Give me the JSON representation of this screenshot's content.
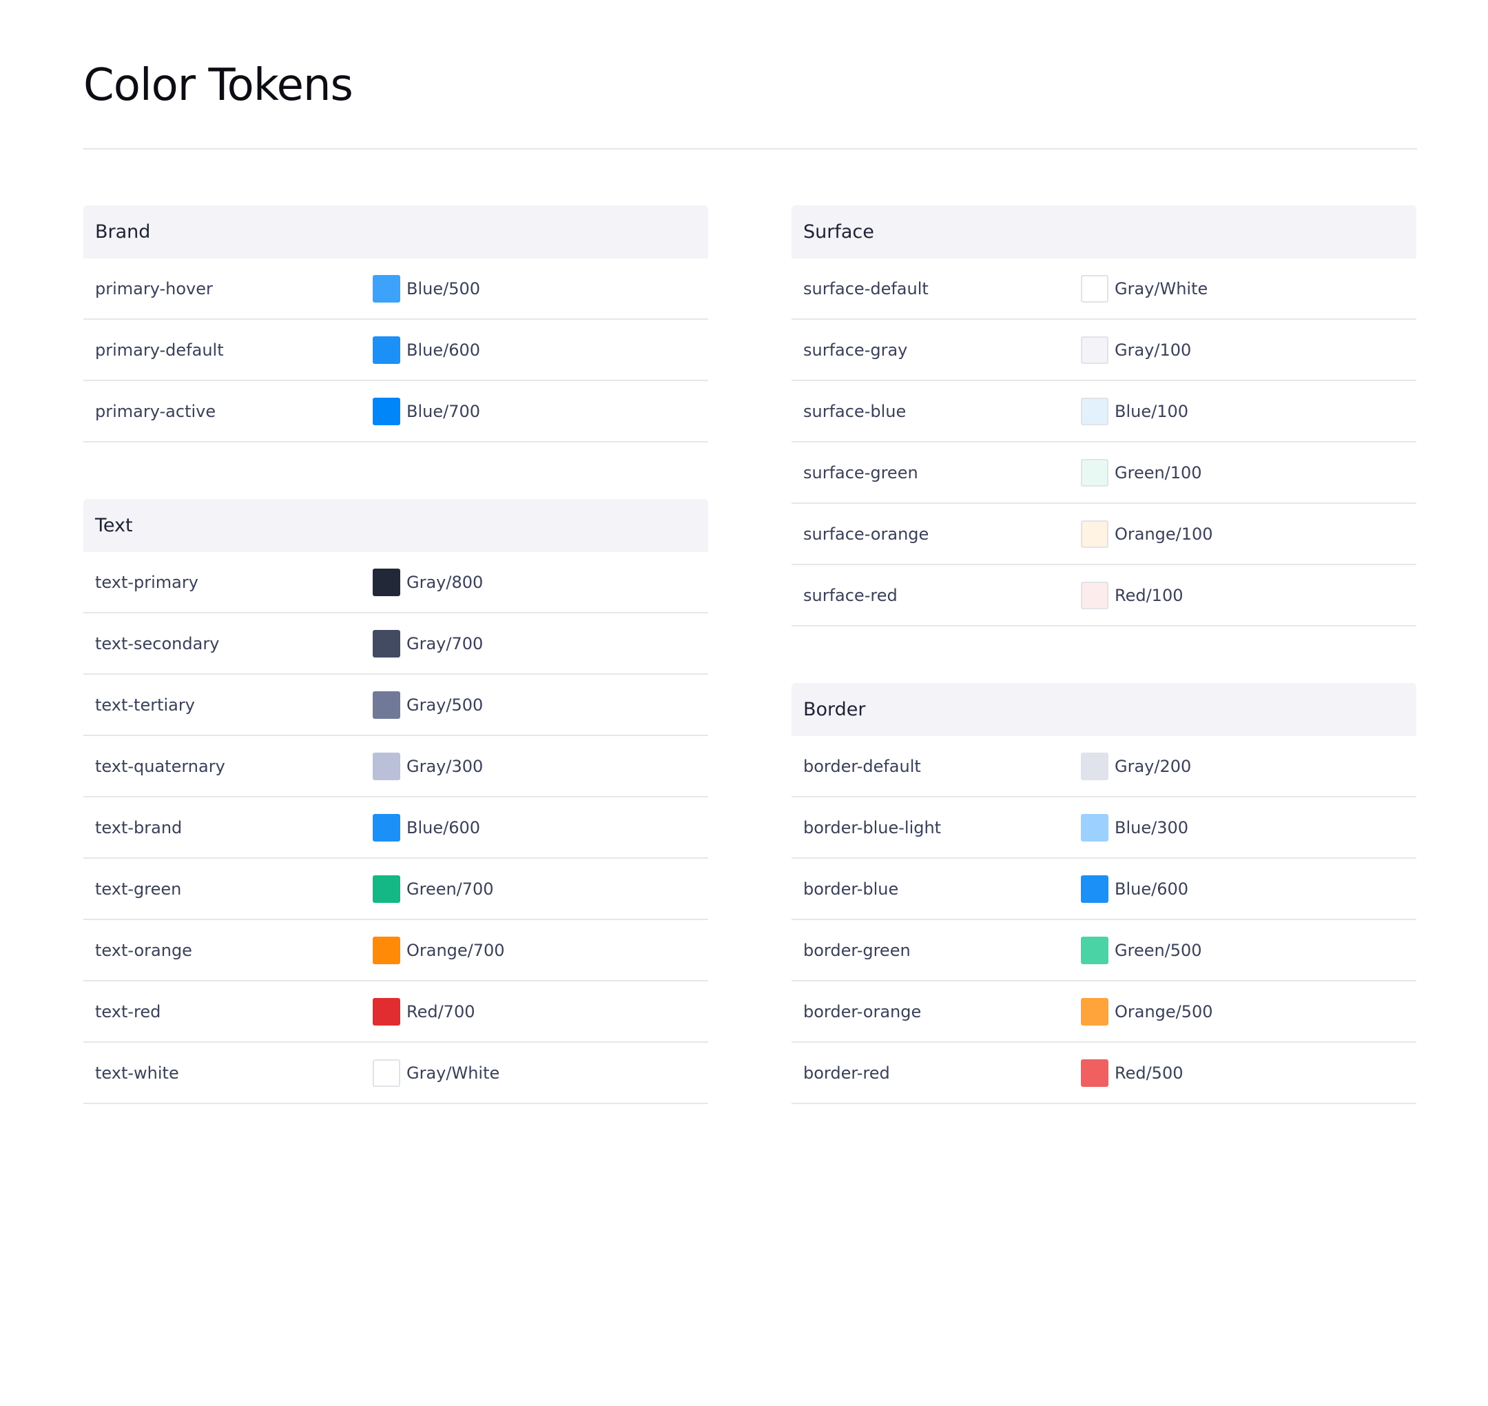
{
  "page": {
    "title": "Color Tokens"
  },
  "sections": {
    "brand": {
      "title": "Brand",
      "rows": [
        {
          "name": "primary-hover",
          "value": "Blue/500",
          "color": "#3DA2FA"
        },
        {
          "name": "primary-default",
          "value": "Blue/600",
          "color": "#1B90F7"
        },
        {
          "name": "primary-active",
          "value": "Blue/700",
          "color": "#0086F8"
        }
      ]
    },
    "text": {
      "title": "Text",
      "rows": [
        {
          "name": "text-primary",
          "value": "Gray/800",
          "color": "#232838"
        },
        {
          "name": "text-secondary",
          "value": "Gray/700",
          "color": "#434B63"
        },
        {
          "name": "text-tertiary",
          "value": "Gray/500",
          "color": "#707A98"
        },
        {
          "name": "text-quaternary",
          "value": "Gray/300",
          "color": "#B9C0D8"
        },
        {
          "name": "text-brand",
          "value": "Blue/600",
          "color": "#1B90F7"
        },
        {
          "name": "text-green",
          "value": "Green/700",
          "color": "#13B885"
        },
        {
          "name": "text-orange",
          "value": "Orange/700",
          "color": "#FF8A07"
        },
        {
          "name": "text-red",
          "value": "Red/700",
          "color": "#E12D2F"
        },
        {
          "name": "text-white",
          "value": "Gray/White",
          "color": "#FFFFFF"
        }
      ]
    },
    "surface": {
      "title": "Surface",
      "rows": [
        {
          "name": "surface-default",
          "value": "Gray/White",
          "color": "#FFFFFF"
        },
        {
          "name": "surface-gray",
          "value": "Gray/100",
          "color": "#F3F3F8"
        },
        {
          "name": "surface-blue",
          "value": "Blue/100",
          "color": "#E3F1FD"
        },
        {
          "name": "surface-green",
          "value": "Green/100",
          "color": "#E8F9F4"
        },
        {
          "name": "surface-orange",
          "value": "Orange/100",
          "color": "#FFF3E3"
        },
        {
          "name": "surface-red",
          "value": "Red/100",
          "color": "#FDECEC"
        }
      ]
    },
    "border": {
      "title": "Border",
      "rows": [
        {
          "name": "border-default",
          "value": "Gray/200",
          "color": "#E0E2EC"
        },
        {
          "name": "border-blue-light",
          "value": "Blue/300",
          "color": "#9CD0FE"
        },
        {
          "name": "border-blue",
          "value": "Blue/600",
          "color": "#1B90F7"
        },
        {
          "name": "border-green",
          "value": "Green/500",
          "color": "#4AD4A6"
        },
        {
          "name": "border-orange",
          "value": "Orange/500",
          "color": "#FFA43A"
        },
        {
          "name": "border-red",
          "value": "Red/500",
          "color": "#F06060"
        }
      ]
    }
  }
}
